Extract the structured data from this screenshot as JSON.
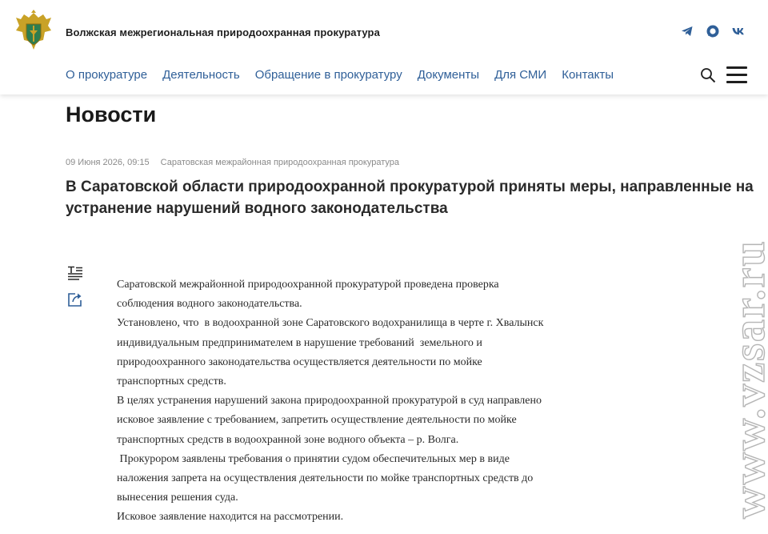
{
  "header": {
    "site_title": "Волжская межрегиональная природоохранная прокуратура",
    "socials": [
      "telegram-icon",
      "max-icon",
      "vk-icon"
    ],
    "nav": [
      "О прокуратуре",
      "Деятельность",
      "Обращение в прокуратуру",
      "Документы",
      "Для СМИ",
      "Контакты"
    ]
  },
  "page": {
    "title": "Новости"
  },
  "article": {
    "date": "09 Июня 2026, 09:15",
    "source": "Саратовская межрайонная природоохранная прокуратура",
    "title": "В Саратовской области природоохранной прокуратурой приняты меры, направленные на устранение нарушений водного законодательства",
    "lines": [
      "Саратовской межрайонной природоохранной прокуратурой проведена проверка",
      "соблюдения водного законодательства.",
      "Установлено, что  в водоохранной зоне Саратовского водохранилища в черте г. Хвалынск",
      "индивидуальным предпринимателем в нарушение требований  земельного и",
      "природоохранного законодательства осуществляется деятельности по мойке",
      "транспортных средств.",
      "В целях устранения нарушений закона природоохранной прокуратурой в суд направлено",
      "исковое заявление с требованием, запретить осуществление деятельности по мойке",
      "транспортных средств в водоохранной зоне водного объекта – р. Волга.",
      " Прокурором заявлены требования о принятии судом обеспечительных мер в виде",
      "наложения запрета на осуществления деятельности по мойке транспортных средств до",
      "вынесения решения суда.",
      "Исковое заявление находится на рассмотрении."
    ]
  },
  "watermark": "www.vzsar.ru",
  "colors": {
    "nav_link": "#2f5f98",
    "logo_gold": "#c9a227",
    "logo_green": "#2e7d4f"
  }
}
